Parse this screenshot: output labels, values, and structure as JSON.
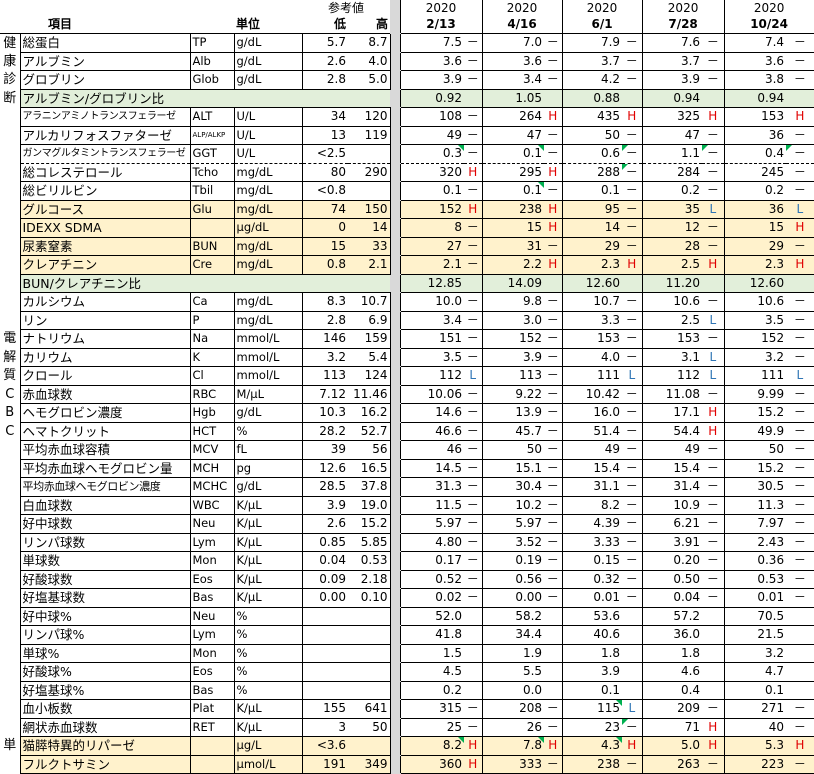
{
  "header": {
    "item_label": "項目",
    "unit_label": "単位",
    "ref_label": "参考値",
    "low_label": "低",
    "high_label": "高",
    "dates": [
      {
        "year": "2020",
        "date": "2/13"
      },
      {
        "year": "2020",
        "date": "4/16"
      },
      {
        "year": "2020",
        "date": "6/1"
      },
      {
        "year": "2020",
        "date": "7/28"
      },
      {
        "year": "2020",
        "date": "10/24"
      }
    ]
  },
  "sections": {
    "kenko": [
      "健",
      "康",
      "診",
      "断"
    ],
    "denkai": [
      "電",
      "解",
      "質"
    ],
    "cbc": [
      "C",
      "B",
      "C"
    ],
    "tan": [
      "単"
    ]
  },
  "colors": {
    "high_flag": "#e00000",
    "low_flag": "#2f75b5",
    "green_row": "#e2efda",
    "orange_row": "#fff2cc",
    "gap_column": "#d9d9d9",
    "note_marker": "#00b050"
  },
  "rows": [
    {
      "name": "総蛋白",
      "code": "TP",
      "unit": "g/dL",
      "lo": "5.7",
      "hi": "8.7",
      "hl": "",
      "vals": [
        [
          "7.5",
          "－"
        ],
        [
          "7.0",
          "－"
        ],
        [
          "7.9",
          "－"
        ],
        [
          "7.6",
          "－"
        ],
        [
          "7.4",
          "－"
        ]
      ]
    },
    {
      "name": "アルブミン",
      "code": "Alb",
      "unit": "g/dL",
      "lo": "2.6",
      "hi": "4.0",
      "hl": "",
      "vals": [
        [
          "3.6",
          "－"
        ],
        [
          "3.6",
          "－"
        ],
        [
          "3.7",
          "－"
        ],
        [
          "3.7",
          "－"
        ],
        [
          "3.6",
          "－"
        ]
      ]
    },
    {
      "name": "グロブリン",
      "code": "Glob",
      "unit": "g/dL",
      "lo": "2.8",
      "hi": "5.0",
      "hl": "",
      "vals": [
        [
          "3.9",
          "－"
        ],
        [
          "3.4",
          "－"
        ],
        [
          "4.2",
          "－"
        ],
        [
          "3.9",
          "－"
        ],
        [
          "3.8",
          "－"
        ]
      ]
    },
    {
      "name": "アルブミン/グロブリン比",
      "code": "",
      "unit": "",
      "lo": "",
      "hi": "",
      "hl": "green",
      "merged": true,
      "vals": [
        [
          "0.92",
          ""
        ],
        [
          "1.05",
          ""
        ],
        [
          "0.88",
          ""
        ],
        [
          "0.94",
          ""
        ],
        [
          "0.94",
          ""
        ]
      ]
    },
    {
      "name": "アラニンアミノトランスフェラーゼ",
      "code": "ALT",
      "unit": "U/L",
      "lo": "34",
      "hi": "120",
      "hl": "",
      "vals": [
        [
          "108",
          "－"
        ],
        [
          "264",
          "H"
        ],
        [
          "435",
          "H"
        ],
        [
          "325",
          "H"
        ],
        [
          "153",
          "H"
        ]
      ]
    },
    {
      "name": "アルカリフォスファターゼ",
      "code": "ALP/ALKP",
      "unit": "U/L",
      "lo": "13",
      "hi": "119",
      "hl": "",
      "vals": [
        [
          "49",
          "－"
        ],
        [
          "47",
          "－"
        ],
        [
          "50",
          "－"
        ],
        [
          "47",
          "－"
        ],
        [
          "36",
          "－"
        ]
      ]
    },
    {
      "name": "ガンマグルタミントランスフェラーゼ",
      "code": "GGT",
      "unit": "U/L",
      "lo": "<2.5",
      "hi": "",
      "hl": "",
      "dashed": true,
      "vals": [
        [
          "0.3",
          "－"
        ],
        [
          "0.1",
          "－"
        ],
        [
          "0.6",
          "－"
        ],
        [
          "1.1",
          "－"
        ],
        [
          "0.4",
          "－"
        ]
      ]
    },
    {
      "name": "総コレステロール",
      "code": "Tcho",
      "unit": "mg/dL",
      "lo": "80",
      "hi": "290",
      "hl": "",
      "vals": [
        [
          "320",
          "H"
        ],
        [
          "295",
          "H"
        ],
        [
          "288",
          "－"
        ],
        [
          "284",
          "－"
        ],
        [
          "245",
          "－"
        ]
      ]
    },
    {
      "name": "総ビリルビン",
      "code": "Tbil",
      "unit": "mg/dL",
      "lo": "<0.8",
      "hi": "",
      "hl": "",
      "vals": [
        [
          "0.1",
          "－"
        ],
        [
          "0.1",
          "－"
        ],
        [
          "0.1",
          "－"
        ],
        [
          "0.2",
          "－"
        ],
        [
          "0.2",
          "－"
        ]
      ]
    },
    {
      "name": "グルコース",
      "code": "Glu",
      "unit": "mg/dL",
      "lo": "74",
      "hi": "150",
      "hl": "orange",
      "vals": [
        [
          "152",
          "H"
        ],
        [
          "238",
          "H"
        ],
        [
          "95",
          "－"
        ],
        [
          "35",
          "L"
        ],
        [
          "36",
          "L"
        ]
      ]
    },
    {
      "name": "IDEXX SDMA",
      "code": "",
      "unit": "μg/dL",
      "lo": "0",
      "hi": "14",
      "hl": "orange",
      "vals": [
        [
          "8",
          "－"
        ],
        [
          "15",
          "H"
        ],
        [
          "14",
          "－"
        ],
        [
          "12",
          "－"
        ],
        [
          "15",
          "H"
        ]
      ]
    },
    {
      "name": "尿素窒素",
      "code": "BUN",
      "unit": "mg/dL",
      "lo": "15",
      "hi": "33",
      "hl": "orange",
      "vals": [
        [
          "27",
          "－"
        ],
        [
          "31",
          "－"
        ],
        [
          "29",
          "－"
        ],
        [
          "28",
          "－"
        ],
        [
          "29",
          "－"
        ]
      ]
    },
    {
      "name": "クレアチニン",
      "code": "Cre",
      "unit": "mg/dL",
      "lo": "0.8",
      "hi": "2.1",
      "hl": "orange",
      "vals": [
        [
          "2.1",
          "－"
        ],
        [
          "2.2",
          "H"
        ],
        [
          "2.3",
          "H"
        ],
        [
          "2.5",
          "H"
        ],
        [
          "2.3",
          "H"
        ]
      ]
    },
    {
      "name": "BUN/クレアチニン比",
      "code": "",
      "unit": "",
      "lo": "",
      "hi": "",
      "hl": "green",
      "merged": true,
      "vals": [
        [
          "12.85",
          ""
        ],
        [
          "14.09",
          ""
        ],
        [
          "12.60",
          ""
        ],
        [
          "11.20",
          ""
        ],
        [
          "12.60",
          ""
        ]
      ]
    },
    {
      "name": "カルシウム",
      "code": "Ca",
      "unit": "mg/dL",
      "lo": "8.3",
      "hi": "10.7",
      "hl": "",
      "vals": [
        [
          "10.0",
          "－"
        ],
        [
          "9.8",
          "－"
        ],
        [
          "10.7",
          "－"
        ],
        [
          "10.6",
          "－"
        ],
        [
          "10.6",
          "－"
        ]
      ]
    },
    {
      "name": "リン",
      "code": "P",
      "unit": "mg/dL",
      "lo": "2.8",
      "hi": "6.9",
      "hl": "",
      "thick": true,
      "vals": [
        [
          "3.4",
          "－"
        ],
        [
          "3.0",
          "－"
        ],
        [
          "3.3",
          "－"
        ],
        [
          "2.5",
          "L"
        ],
        [
          "3.5",
          "－"
        ]
      ]
    },
    {
      "name": "ナトリウム",
      "code": "Na",
      "unit": "mmol/L",
      "lo": "146",
      "hi": "159",
      "hl": "",
      "vals": [
        [
          "151",
          "－"
        ],
        [
          "152",
          "－"
        ],
        [
          "153",
          "－"
        ],
        [
          "153",
          "－"
        ],
        [
          "152",
          "－"
        ]
      ]
    },
    {
      "name": "カリウム",
      "code": "K",
      "unit": "mmol/L",
      "lo": "3.2",
      "hi": "5.4",
      "hl": "",
      "vals": [
        [
          "3.5",
          "－"
        ],
        [
          "3.9",
          "－"
        ],
        [
          "4.0",
          "－"
        ],
        [
          "3.1",
          "L"
        ],
        [
          "3.2",
          "－"
        ]
      ]
    },
    {
      "name": "クロール",
      "code": "Cl",
      "unit": "mmol/L",
      "lo": "113",
      "hi": "124",
      "hl": "",
      "thick": true,
      "vals": [
        [
          "112",
          "L"
        ],
        [
          "113",
          "－"
        ],
        [
          "111",
          "L"
        ],
        [
          "112",
          "L"
        ],
        [
          "111",
          "L"
        ]
      ]
    },
    {
      "name": "赤血球数",
      "code": "RBC",
      "unit": "M/μL",
      "lo": "7.12",
      "hi": "11.46",
      "hl": "",
      "vals": [
        [
          "10.06",
          "－"
        ],
        [
          "9.22",
          "－"
        ],
        [
          "10.42",
          "－"
        ],
        [
          "11.08",
          "－"
        ],
        [
          "9.99",
          "－"
        ]
      ]
    },
    {
      "name": "ヘモグロビン濃度",
      "code": "Hgb",
      "unit": "g/dL",
      "lo": "10.3",
      "hi": "16.2",
      "hl": "",
      "vals": [
        [
          "14.6",
          "－"
        ],
        [
          "13.9",
          "－"
        ],
        [
          "16.0",
          "－"
        ],
        [
          "17.1",
          "H"
        ],
        [
          "15.2",
          "－"
        ]
      ]
    },
    {
      "name": "ヘマトクリット",
      "code": "HCT",
      "unit": "%",
      "lo": "28.2",
      "hi": "52.7",
      "hl": "",
      "vals": [
        [
          "46.6",
          "－"
        ],
        [
          "45.7",
          "－"
        ],
        [
          "51.4",
          "－"
        ],
        [
          "54.4",
          "H"
        ],
        [
          "49.9",
          "－"
        ]
      ]
    },
    {
      "name": "平均赤血球容積",
      "code": "MCV",
      "unit": "fL",
      "lo": "39",
      "hi": "56",
      "hl": "",
      "vals": [
        [
          "46",
          "－"
        ],
        [
          "50",
          "－"
        ],
        [
          "49",
          "－"
        ],
        [
          "49",
          "－"
        ],
        [
          "50",
          "－"
        ]
      ]
    },
    {
      "name": "平均赤血球ヘモグロビン量",
      "code": "MCH",
      "unit": "pg",
      "lo": "12.6",
      "hi": "16.5",
      "hl": "",
      "vals": [
        [
          "14.5",
          "－"
        ],
        [
          "15.1",
          "－"
        ],
        [
          "15.4",
          "－"
        ],
        [
          "15.4",
          "－"
        ],
        [
          "15.2",
          "－"
        ]
      ]
    },
    {
      "name": "平均赤血球ヘモグロビン濃度",
      "code": "MCHC",
      "unit": "g/dL",
      "lo": "28.5",
      "hi": "37.8",
      "hl": "",
      "vals": [
        [
          "31.3",
          "－"
        ],
        [
          "30.4",
          "－"
        ],
        [
          "31.1",
          "－"
        ],
        [
          "31.4",
          "－"
        ],
        [
          "30.5",
          "－"
        ]
      ]
    },
    {
      "name": "白血球数",
      "code": "WBC",
      "unit": "K/μL",
      "lo": "3.9",
      "hi": "19.0",
      "hl": "",
      "vals": [
        [
          "11.5",
          "－"
        ],
        [
          "10.2",
          "－"
        ],
        [
          "8.2",
          "－"
        ],
        [
          "10.9",
          "－"
        ],
        [
          "11.3",
          "－"
        ]
      ]
    },
    {
      "name": "好中球数",
      "code": "Neu",
      "unit": "K/μL",
      "lo": "2.6",
      "hi": "15.2",
      "hl": "",
      "vals": [
        [
          "5.97",
          "－"
        ],
        [
          "5.97",
          "－"
        ],
        [
          "4.39",
          "－"
        ],
        [
          "6.21",
          "－"
        ],
        [
          "7.97",
          "－"
        ]
      ]
    },
    {
      "name": "リンパ球数",
      "code": "Lym",
      "unit": "K/μL",
      "lo": "0.85",
      "hi": "5.85",
      "hl": "",
      "vals": [
        [
          "4.80",
          "－"
        ],
        [
          "3.52",
          "－"
        ],
        [
          "3.33",
          "－"
        ],
        [
          "3.91",
          "－"
        ],
        [
          "2.43",
          "－"
        ]
      ]
    },
    {
      "name": "単球数",
      "code": "Mon",
      "unit": "K/μL",
      "lo": "0.04",
      "hi": "0.53",
      "hl": "",
      "vals": [
        [
          "0.17",
          "－"
        ],
        [
          "0.19",
          "－"
        ],
        [
          "0.15",
          "－"
        ],
        [
          "0.20",
          "－"
        ],
        [
          "0.36",
          "－"
        ]
      ]
    },
    {
      "name": "好酸球数",
      "code": "Eos",
      "unit": "K/μL",
      "lo": "0.09",
      "hi": "2.18",
      "hl": "",
      "vals": [
        [
          "0.52",
          "－"
        ],
        [
          "0.56",
          "－"
        ],
        [
          "0.32",
          "－"
        ],
        [
          "0.50",
          "－"
        ],
        [
          "0.53",
          "－"
        ]
      ]
    },
    {
      "name": "好塩基球数",
      "code": "Bas",
      "unit": "K/μL",
      "lo": "0.00",
      "hi": "0.10",
      "hl": "",
      "vals": [
        [
          "0.02",
          "－"
        ],
        [
          "0.00",
          "－"
        ],
        [
          "0.01",
          "－"
        ],
        [
          "0.04",
          "－"
        ],
        [
          "0.01",
          "－"
        ]
      ]
    },
    {
      "name": "好中球%",
      "code": "Neu",
      "unit": "%",
      "lo": "",
      "hi": "",
      "hl": "",
      "vals": [
        [
          "52.0",
          ""
        ],
        [
          "58.2",
          ""
        ],
        [
          "53.6",
          ""
        ],
        [
          "57.2",
          ""
        ],
        [
          "70.5",
          ""
        ]
      ]
    },
    {
      "name": "リンパ球%",
      "code": "Lym",
      "unit": "%",
      "lo": "",
      "hi": "",
      "hl": "",
      "vals": [
        [
          "41.8",
          ""
        ],
        [
          "34.4",
          ""
        ],
        [
          "40.6",
          ""
        ],
        [
          "36.0",
          ""
        ],
        [
          "21.5",
          ""
        ]
      ]
    },
    {
      "name": "単球%",
      "code": "Mon",
      "unit": "%",
      "lo": "",
      "hi": "",
      "hl": "",
      "vals": [
        [
          "1.5",
          ""
        ],
        [
          "1.9",
          ""
        ],
        [
          "1.8",
          ""
        ],
        [
          "1.8",
          ""
        ],
        [
          "3.2",
          ""
        ]
      ]
    },
    {
      "name": "好酸球%",
      "code": "Eos",
      "unit": "%",
      "lo": "",
      "hi": "",
      "hl": "",
      "vals": [
        [
          "4.5",
          ""
        ],
        [
          "5.5",
          ""
        ],
        [
          "3.9",
          ""
        ],
        [
          "4.6",
          ""
        ],
        [
          "4.7",
          ""
        ]
      ]
    },
    {
      "name": "好塩基球%",
      "code": "Bas",
      "unit": "%",
      "lo": "",
      "hi": "",
      "hl": "",
      "vals": [
        [
          "0.2",
          ""
        ],
        [
          "0.0",
          ""
        ],
        [
          "0.1",
          ""
        ],
        [
          "0.4",
          ""
        ],
        [
          "0.1",
          ""
        ]
      ]
    },
    {
      "name": "血小板数",
      "code": "Plat",
      "unit": "K/μL",
      "lo": "155",
      "hi": "641",
      "hl": "",
      "vals": [
        [
          "315",
          "－"
        ],
        [
          "208",
          "－"
        ],
        [
          "115",
          "L"
        ],
        [
          "209",
          "－"
        ],
        [
          "271",
          "－"
        ]
      ]
    },
    {
      "name": "網状赤血球数",
      "code": "RET",
      "unit": "K/μL",
      "lo": "3",
      "hi": "50",
      "hl": "",
      "thick": true,
      "vals": [
        [
          "25",
          "－"
        ],
        [
          "26",
          "－"
        ],
        [
          "23",
          "－"
        ],
        [
          "71",
          "H"
        ],
        [
          "40",
          "－"
        ]
      ]
    },
    {
      "name": "猫膵特異的リパーゼ",
      "code": "",
      "unit": "μg/L",
      "lo": "<3.6",
      "hi": "",
      "hl": "orange",
      "vals": [
        [
          "8.2",
          "H"
        ],
        [
          "7.8",
          "H"
        ],
        [
          "4.3",
          "H"
        ],
        [
          "5.0",
          "H"
        ],
        [
          "5.3",
          "H"
        ]
      ]
    },
    {
      "name": "フルクトサミン",
      "code": "",
      "unit": "μmol/L",
      "lo": "191",
      "hi": "349",
      "hl": "orange",
      "vals": [
        [
          "360",
          "H"
        ],
        [
          "333",
          "－"
        ],
        [
          "238",
          "－"
        ],
        [
          "263",
          "－"
        ],
        [
          "223",
          "－"
        ]
      ]
    }
  ]
}
